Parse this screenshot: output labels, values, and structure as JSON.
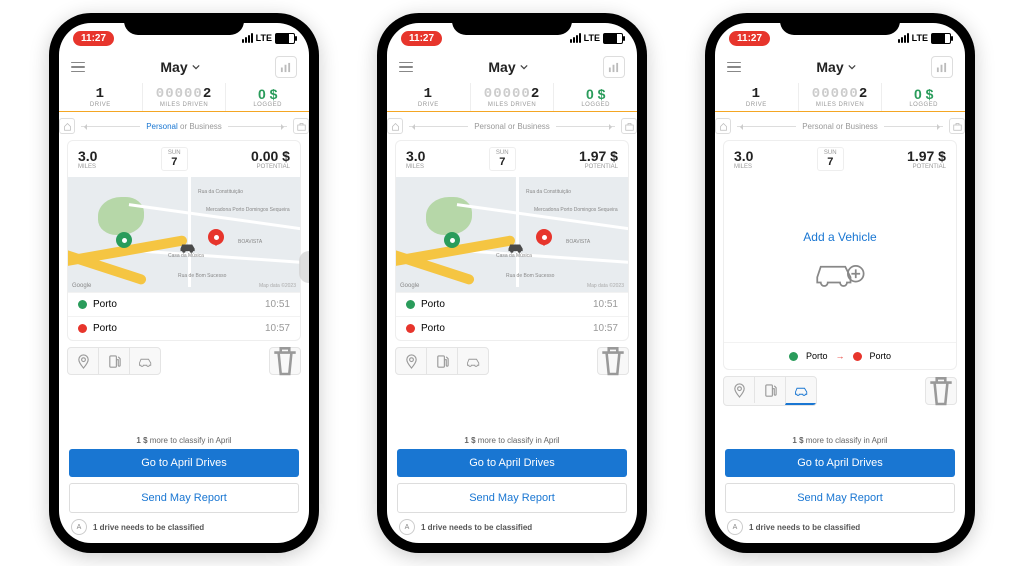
{
  "status": {
    "time": "11:27",
    "net": "LTE"
  },
  "header": {
    "month": "May"
  },
  "stats": {
    "drive": {
      "value": "1",
      "label": "DRIVE"
    },
    "miles": {
      "prefix": "00000",
      "value": "2",
      "label": "MILES DRIVEN"
    },
    "logged": {
      "value": "0 $",
      "label": "LOGGED"
    }
  },
  "hint": {
    "personal": "Personal",
    "or": " or ",
    "business": "Business"
  },
  "cards": [
    {
      "miles": "3.0",
      "miles_lbl": "MILES",
      "day": "SUN",
      "date": "7",
      "pot": "0.00 $",
      "pot_lbl": "POTENTIAL"
    },
    {
      "miles": "3.0",
      "miles_lbl": "MILES",
      "day": "SUN",
      "date": "7",
      "pot": "1.97 $",
      "pot_lbl": "POTENTIAL"
    },
    {
      "miles": "3.0",
      "miles_lbl": "MILES",
      "day": "SUN",
      "date": "7",
      "pot": "1.97 $",
      "pot_lbl": "POTENTIAL"
    }
  ],
  "map": {
    "labels": {
      "a": "Rua da Constituição",
      "b": "Mercadona Porto Domingos Sequeira",
      "c": "Casa da Música",
      "d": "BOAVISTA",
      "e": "Rua de Bom Sucesso"
    },
    "logo": "Google",
    "attr": "Map data ©2023"
  },
  "locs": [
    {
      "name": "Porto",
      "time": "10:51"
    },
    {
      "name": "Porto",
      "time": "10:57"
    }
  ],
  "add_vehicle": "Add a Vehicle",
  "inline_from": "Porto",
  "inline_to": "Porto",
  "bottom": {
    "note1_a": "1 $",
    "note1_b": " more to classify in April",
    "btn1": "Go to April Drives",
    "btn2": "Send May Report",
    "note2": "1 drive needs to be classified"
  }
}
